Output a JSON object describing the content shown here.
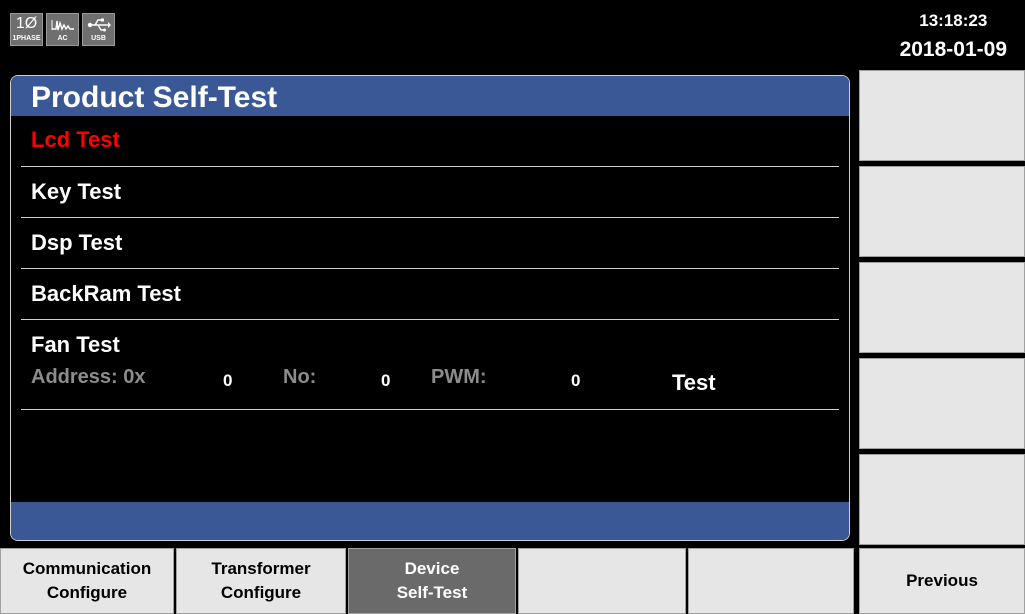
{
  "status": {
    "phase_icon": {
      "big": "1Ø",
      "small": "1PHASE"
    },
    "ac_icon": {
      "small": "AC",
      "icon": "ac-waveform-icon"
    },
    "usb_icon": {
      "small": "USB",
      "icon": "usb-icon"
    },
    "time": "13:18:23",
    "date": "2018-01-09"
  },
  "panel": {
    "title": "Product Self-Test",
    "items": [
      {
        "label": "Lcd Test",
        "selected": true
      },
      {
        "label": "Key Test"
      },
      {
        "label": "Dsp Test"
      },
      {
        "label": "BackRam Test"
      },
      {
        "label": "Fan Test"
      }
    ],
    "fan": {
      "address_label": "Address: 0x",
      "address_value": "0",
      "no_label": "No:",
      "no_value": "0",
      "pwm_label": "PWM:",
      "pwm_value": "0",
      "test_label": "Test"
    }
  },
  "colors": {
    "title_bar": "#3a5896",
    "selected_text": "#ff0000",
    "soft_key": "#e6e6e6",
    "active_soft_key": "#6a6a6a"
  },
  "bottom_keys": [
    {
      "line1": "Communication",
      "line2": "Configure"
    },
    {
      "line1": "Transformer",
      "line2": "Configure"
    },
    {
      "line1": "Device",
      "line2": "Self-Test",
      "active": true
    },
    {
      "line1": "",
      "line2": ""
    },
    {
      "line1": "",
      "line2": ""
    },
    {
      "line1": "Previous",
      "line2": ""
    }
  ]
}
